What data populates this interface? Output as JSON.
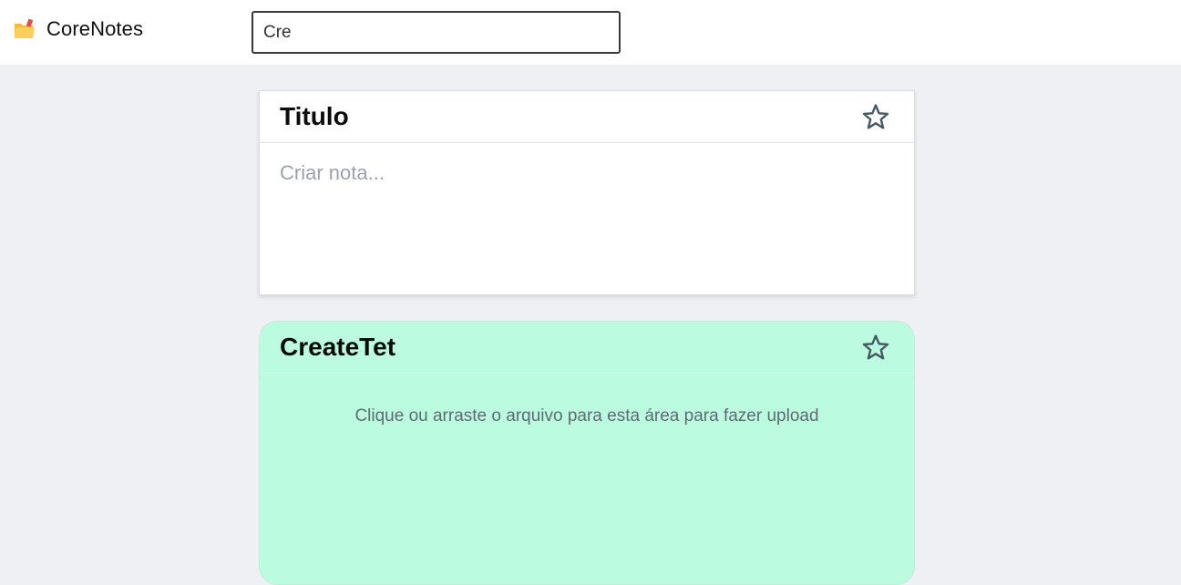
{
  "header": {
    "app_name": "CoreNotes",
    "logo_icon": "folder-icon",
    "search_value": "Cre"
  },
  "new_note": {
    "title": "Titulo",
    "body_placeholder": "Criar nota...",
    "favorite_icon": "star-outline-icon"
  },
  "notes": [
    {
      "title": "CreateTet",
      "upload_hint": "Clique ou arraste o arquivo para esta área para fazer upload",
      "favorite_icon": "star-outline-icon",
      "color": "#bbfce0"
    }
  ],
  "colors": {
    "background": "#eff0f3",
    "topbar": "#ffffff",
    "note_green": "#bbfce0",
    "star_stroke": "#455a64"
  }
}
